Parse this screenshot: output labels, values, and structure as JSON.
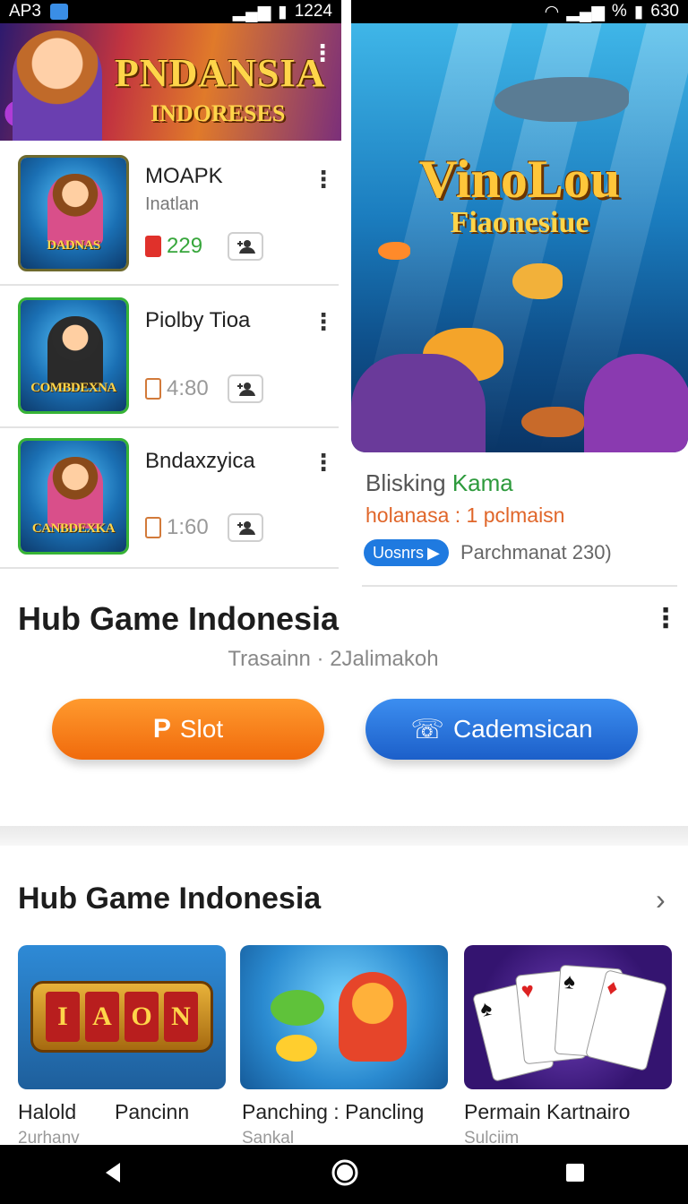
{
  "status_left": {
    "carrier": "AP3",
    "time": "1224"
  },
  "status_right": {
    "signal": "%",
    "time": "630"
  },
  "banner": {
    "title_line1": "PNDANSIA",
    "title_line2": "INDORESES"
  },
  "list": [
    {
      "thumb_label": "DADNAS",
      "name": "MOAPK",
      "sub": "Inatlan",
      "stat": "229"
    },
    {
      "thumb_label": "COMBDEXNA",
      "name": "Piolby Tioa",
      "sub": "",
      "stat": "4:80"
    },
    {
      "thumb_label": "CANBDEXKA",
      "name": "Bndaxzyica",
      "sub": "",
      "stat": "1:60"
    }
  ],
  "feature": {
    "art_title": "VinoLou",
    "art_subtitle": "Fiaonesiue",
    "title_prefix": "Blisking",
    "title_highlight": "Kama",
    "subtitle": "holanasa : 1 pclmaisn",
    "badge": "Uosnrs",
    "meta": "Parchmanat 230)"
  },
  "hub": {
    "title": "Hub Game Indonesia",
    "subtitle": "Trasainn · 2Jalimakoh",
    "btn_slot": "Slot",
    "btn_other": "Cademsican"
  },
  "section2": {
    "title": "Hub Game Indonesia",
    "cards": [
      {
        "reel": [
          "I",
          "A",
          "O",
          "N"
        ],
        "caption_a": "Halold",
        "caption_b": "Pancinn",
        "sub": "2urhanv"
      },
      {
        "caption": "Panching : Pancling",
        "sub": "Sankal"
      },
      {
        "caption": "Permain Kartnairo",
        "sub": "Sulciim"
      }
    ]
  },
  "colors": {
    "orange": "#f27a14",
    "blue": "#2672dc",
    "green": "#2d9a3c",
    "accent_red": "#e0312b"
  }
}
